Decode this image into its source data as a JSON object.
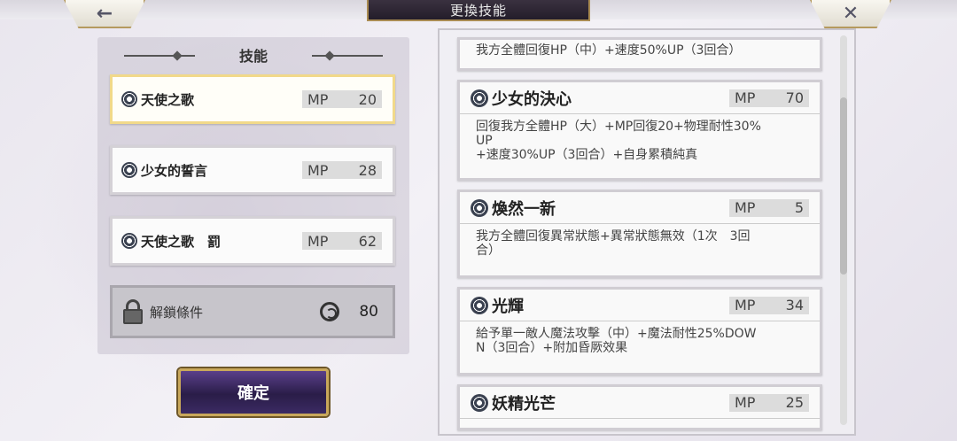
{
  "title": "更換技能",
  "nav": {
    "back_icon": "←",
    "close_icon": "✕"
  },
  "left": {
    "header": "技能",
    "slots": [
      {
        "name": "天使之歌",
        "mp_label": "MP",
        "mp": "20"
      },
      {
        "name": "少女的誓言",
        "mp_label": "MP",
        "mp": "28"
      },
      {
        "name": "天使之歌　罰",
        "mp_label": "MP",
        "mp": "62"
      }
    ],
    "lock": {
      "label": "解鎖條件",
      "value": "80"
    }
  },
  "confirm_label": "確定",
  "right": {
    "partial_desc": "我方全體回復HP（中）+速度50%UP（3回合）",
    "skills": [
      {
        "name": "少女的決心",
        "mp_label": "MP",
        "mp": "70",
        "desc": [
          "回復我方全體HP（大）+MP回復20+物理耐性30%",
          "UP",
          "+速度30%UP（3回合）+自身累積純真"
        ]
      },
      {
        "name": "煥然一新",
        "mp_label": "MP",
        "mp": "5",
        "desc": [
          "我方全體回復異常狀態+異常狀態無效（1次　3回",
          "合）"
        ]
      },
      {
        "name": "光輝",
        "mp_label": "MP",
        "mp": "34",
        "desc": [
          "給予單一敵人魔法攻擊（中）+魔法耐性25%DOW",
          "N（3回合）+附加昏厥效果"
        ]
      },
      {
        "name": "妖精光芒",
        "mp_label": "MP",
        "mp": "25",
        "desc": []
      }
    ]
  }
}
